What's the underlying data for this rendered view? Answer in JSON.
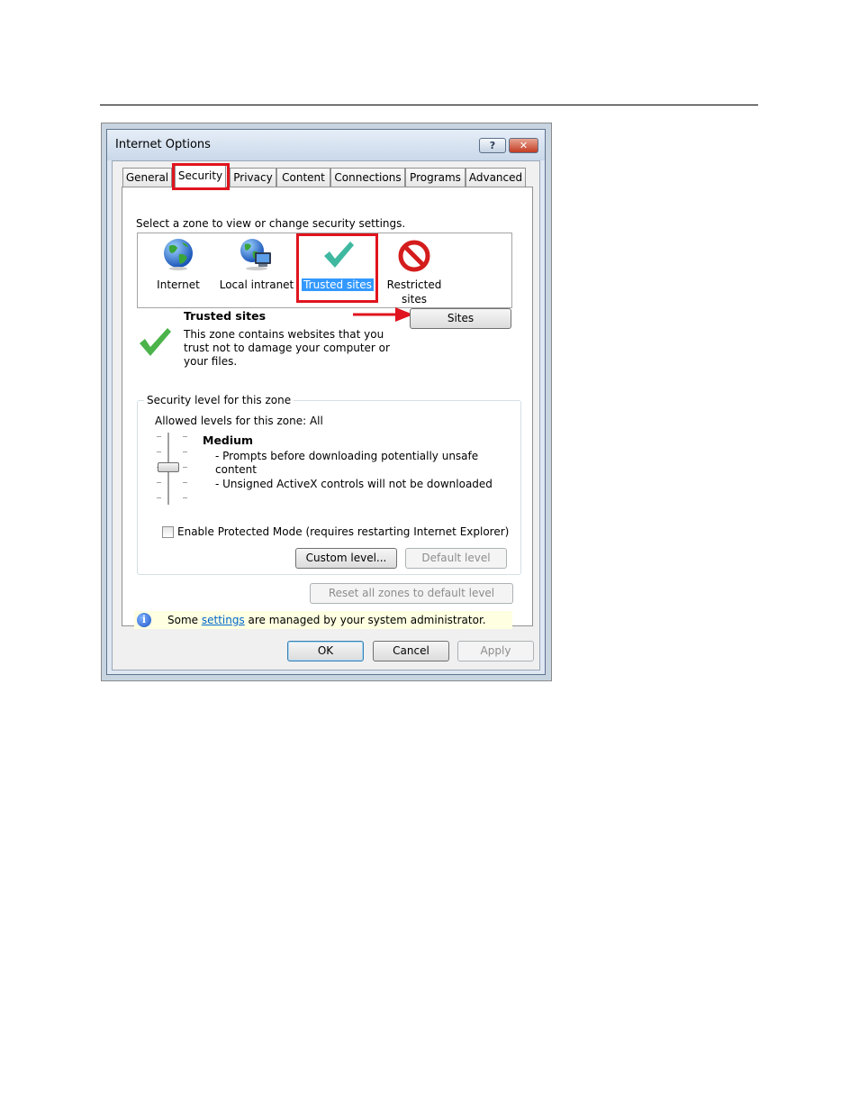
{
  "window": {
    "title": "Internet Options",
    "help_label": "?",
    "close_label": "✕"
  },
  "tabs": [
    {
      "label": "General"
    },
    {
      "label": "Security"
    },
    {
      "label": "Privacy"
    },
    {
      "label": "Content"
    },
    {
      "label": "Connections"
    },
    {
      "label": "Programs"
    },
    {
      "label": "Advanced"
    }
  ],
  "security": {
    "zone_prompt": "Select a zone to view or change security settings.",
    "zones": [
      {
        "label": "Internet",
        "icon": "globe-icon"
      },
      {
        "label": "Local intranet",
        "icon": "intranet-icon"
      },
      {
        "label": "Trusted sites",
        "icon": "checkmark-icon",
        "selected": true
      },
      {
        "label_line1": "Restricted",
        "label_line2": "sites",
        "icon": "prohibited-icon"
      }
    ],
    "selected_zone": {
      "title": "Trusted sites",
      "desc_line1": "This zone contains websites that you",
      "desc_line2": "trust not to damage your computer or",
      "desc_line3": "your files.",
      "sites_button": "Sites"
    },
    "level_group": {
      "legend": "Security level for this zone",
      "allowed": "Allowed levels for this zone: All",
      "level_name": "Medium",
      "bullet1_line1": "- Prompts before downloading potentially unsafe",
      "bullet1_line2": "content",
      "bullet2": "- Unsigned ActiveX controls will not be downloaded",
      "slider_level": 3,
      "slider_levels_total": 5,
      "protected_mode_label": "Enable Protected Mode (requires restarting Internet Explorer)",
      "protected_mode_checked": false,
      "custom_level_button": "Custom level...",
      "default_level_button": "Default level"
    },
    "reset_all_button": "Reset all zones to default level",
    "info": {
      "prefix": "Some ",
      "link": "settings",
      "suffix": " are managed by your system administrator."
    }
  },
  "footer": {
    "ok": "OK",
    "cancel": "Cancel",
    "apply": "Apply"
  },
  "colors": {
    "annotation_red": "#e0141e",
    "selection_blue": "#3399ff",
    "check_green": "#4bb34a"
  }
}
